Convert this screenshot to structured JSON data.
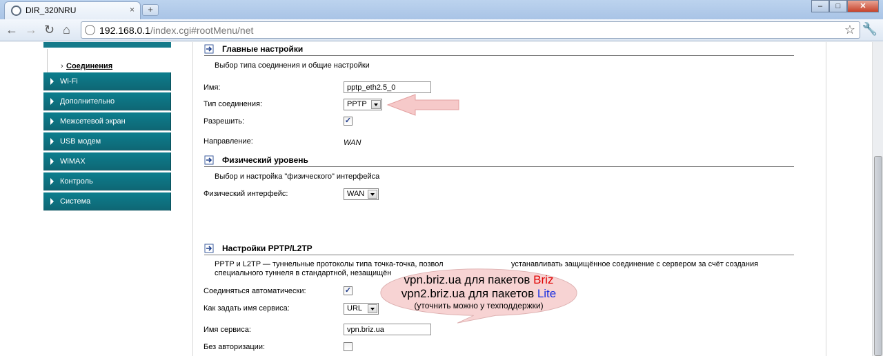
{
  "browser": {
    "tab_title": "DIR_320NRU",
    "tab_close": "×",
    "new_tab": "+",
    "url_host": "192.168.0.1",
    "url_path": "/index.cgi#rootMenu/net",
    "win_minimize": "–",
    "win_maximize": "□",
    "win_close": "✕"
  },
  "sidebar": {
    "sub_item": "Соединения",
    "items": [
      {
        "label": "Wi-Fi"
      },
      {
        "label": "Дополнительно"
      },
      {
        "label": "Межсетевой экран"
      },
      {
        "label": "USB модем"
      },
      {
        "label": "WiMAX"
      },
      {
        "label": "Контроль"
      },
      {
        "label": "Система"
      }
    ]
  },
  "main_settings": {
    "title": "Главные настройки",
    "desc": "Выбор типа соединения и общие настройки",
    "name_label": "Имя:",
    "name_value": "pptp_eth2.5_0",
    "conn_type_label": "Тип соединения:",
    "conn_type_value": "PPTP",
    "enable_label": "Разрешить:",
    "enable_checked": true,
    "direction_label": "Направление:",
    "direction_value": "WAN"
  },
  "physical": {
    "title": "Физический уровень",
    "desc": "Выбор и настройка \"физического\" интерфейса",
    "iface_label": "Физический интерфейс:",
    "iface_value": "WAN"
  },
  "pptp": {
    "title": "Настройки PPTP/L2TP",
    "desc_line1": "PPTP и L2TP — туннельные протоколы типа точка-точка, позвол",
    "desc_line1_tail": "устанавливать защищённое соединение с сервером за счёт создания",
    "desc_line2": "специального туннеля в стандартной, незащищён",
    "auto_label": "Соединяться автоматически:",
    "auto_checked": true,
    "service_how_label": "Как задать имя сервиса:",
    "service_how_value": "URL",
    "service_name_label": "Имя сервиса:",
    "service_name_value": "vpn.briz.ua",
    "no_auth_label": "Без авторизации:",
    "no_auth_checked": false
  },
  "callout": {
    "line1_prefix": "vpn.briz.ua для пакетов ",
    "line1_brand": "Briz",
    "line2_prefix": "vpn2.briz.ua для пакетов ",
    "line2_brand": "Lite",
    "line3": "(уточнить можно у техподдержки)",
    "red": "#e00000",
    "blue": "#1a2fe0"
  },
  "colors": {
    "menu_teal": "#0c7e8e",
    "arrow_pink": "#f6c9c9"
  }
}
